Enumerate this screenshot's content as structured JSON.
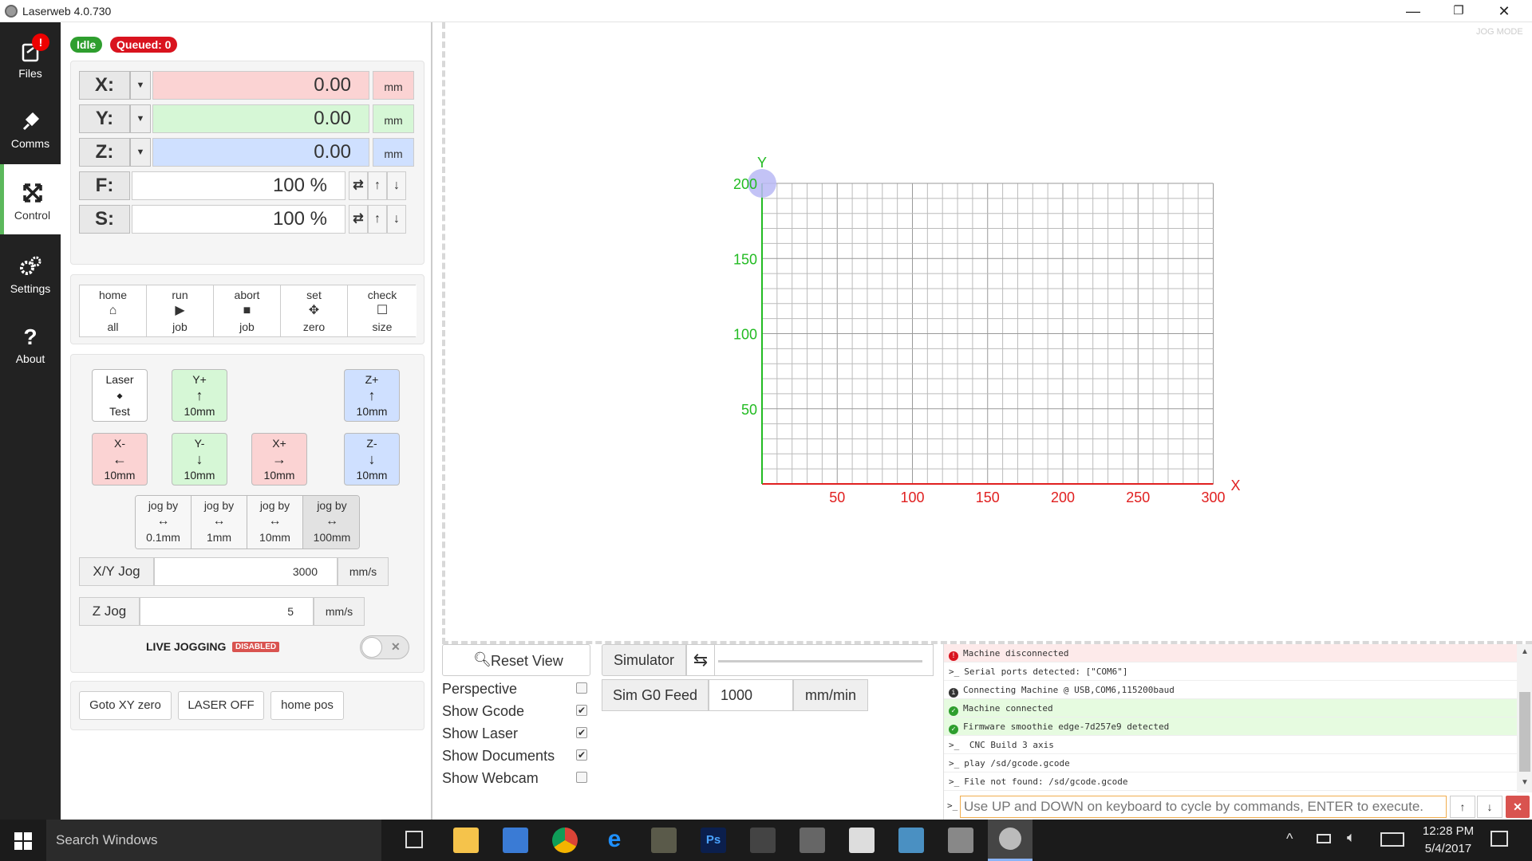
{
  "window": {
    "title": "Laserweb 4.0.730",
    "minimize": "—",
    "restore": "❐",
    "close": "✕"
  },
  "sidebar": {
    "items": [
      {
        "label": "Files",
        "icon": "files-icon",
        "badge": "!"
      },
      {
        "label": "Comms",
        "icon": "plug-icon"
      },
      {
        "label": "Control",
        "icon": "move-icon",
        "active": true
      },
      {
        "label": "Settings",
        "icon": "gears-icon"
      },
      {
        "label": "About",
        "icon": "question-icon"
      }
    ]
  },
  "status": {
    "state": "Idle",
    "queued": "Queued: 0",
    "state_color": "#2e9e2e",
    "queued_color": "#d9131e"
  },
  "dro": {
    "x": {
      "label": "X:",
      "value": "0.00",
      "unit": "mm",
      "color": "#fbd3d3"
    },
    "y": {
      "label": "Y:",
      "value": "0.00",
      "unit": "mm",
      "color": "#d6f7d6"
    },
    "z": {
      "label": "Z:",
      "value": "0.00",
      "unit": "mm",
      "color": "#cfe0ff"
    },
    "f": {
      "label": "F:",
      "value": "100 %"
    },
    "s": {
      "label": "S:",
      "value": "100 %"
    }
  },
  "actions": [
    {
      "top": "home",
      "icon": "home-icon",
      "bottom": "all"
    },
    {
      "top": "run",
      "icon": "play-icon",
      "bottom": "job"
    },
    {
      "top": "abort",
      "icon": "stop-icon",
      "bottom": "job"
    },
    {
      "top": "set",
      "icon": "crosshair-icon",
      "bottom": "zero"
    },
    {
      "top": "check",
      "icon": "square-icon",
      "bottom": "size"
    }
  ],
  "jog": {
    "laser_test": {
      "top": "Laser",
      "bottom": "Test"
    },
    "y_plus": {
      "top": "Y+",
      "bottom": "10mm"
    },
    "z_plus": {
      "top": "Z+",
      "bottom": "10mm"
    },
    "x_minus": {
      "top": "X-",
      "bottom": "10mm"
    },
    "y_minus": {
      "top": "Y-",
      "bottom": "10mm"
    },
    "x_plus": {
      "top": "X+",
      "bottom": "10mm"
    },
    "z_minus": {
      "top": "Z-",
      "bottom": "10mm"
    },
    "steps": [
      {
        "top": "jog by",
        "bottom": "0.1mm"
      },
      {
        "top": "jog by",
        "bottom": "1mm"
      },
      {
        "top": "jog by",
        "bottom": "10mm"
      },
      {
        "top": "jog by",
        "bottom": "100mm"
      }
    ],
    "xy_jog": {
      "label": "X/Y Jog",
      "value": "3000",
      "unit": "mm/s"
    },
    "z_jog": {
      "label": "Z Jog",
      "value": "5",
      "unit": "mm/s"
    },
    "live_label": "LIVE JOGGING",
    "live_badge": "DISABLED"
  },
  "bottom_buttons": {
    "goto": "Goto XY zero",
    "laser_off": "LASER OFF",
    "home_pos": "home pos"
  },
  "canvas": {
    "jog_mode": "JOG MODE",
    "x_axis_label": "X",
    "y_axis_label": "Y",
    "x_ticks": [
      "50",
      "100",
      "150",
      "200",
      "250",
      "300"
    ],
    "y_ticks": [
      "50",
      "100",
      "150",
      "200"
    ],
    "bed_width_mm": 300,
    "bed_height_mm": 200,
    "grid_step_mm": 10,
    "x_color": "#e02020",
    "y_color": "#22bb22"
  },
  "view_controls": {
    "reset_view": "Reset View",
    "options": [
      {
        "label": "Perspective",
        "checked": false
      },
      {
        "label": "Show Gcode",
        "checked": true
      },
      {
        "label": "Show Laser",
        "checked": true
      },
      {
        "label": "Show Documents",
        "checked": true
      },
      {
        "label": "Show Webcam",
        "checked": false
      }
    ],
    "simulator": "Simulator",
    "sim_feed_label": "Sim G0 Feed",
    "sim_feed_value": "1000",
    "sim_feed_unit": "mm/min"
  },
  "console": {
    "lines": [
      {
        "type": "err",
        "prefix": "!",
        "text": "Machine disconnected"
      },
      {
        "type": "info",
        "prefix": ">_",
        "text": "Serial ports detected: [\"COM6\"]"
      },
      {
        "type": "info2",
        "prefix": "i",
        "text": "Connecting Machine @ USB,COM6,115200baud"
      },
      {
        "type": "ok",
        "prefix": "✓",
        "text": "Machine connected"
      },
      {
        "type": "ok",
        "prefix": "✓",
        "text": "Firmware smoothie edge-7d257e9 detected"
      },
      {
        "type": "info",
        "prefix": ">_",
        "text": "  CNC Build 3 axis"
      },
      {
        "type": "info",
        "prefix": ">_",
        "text": "play /sd/gcode.gcode"
      },
      {
        "type": "info",
        "prefix": ">_",
        "text": "File not found: /sd/gcode.gcode"
      }
    ],
    "prompt": ">_",
    "placeholder": "Use UP and DOWN on keyboard to cycle by commands, ENTER to execute."
  },
  "taskbar": {
    "search": "Search Windows",
    "time": "12:28 PM",
    "date": "5/4/2017"
  }
}
